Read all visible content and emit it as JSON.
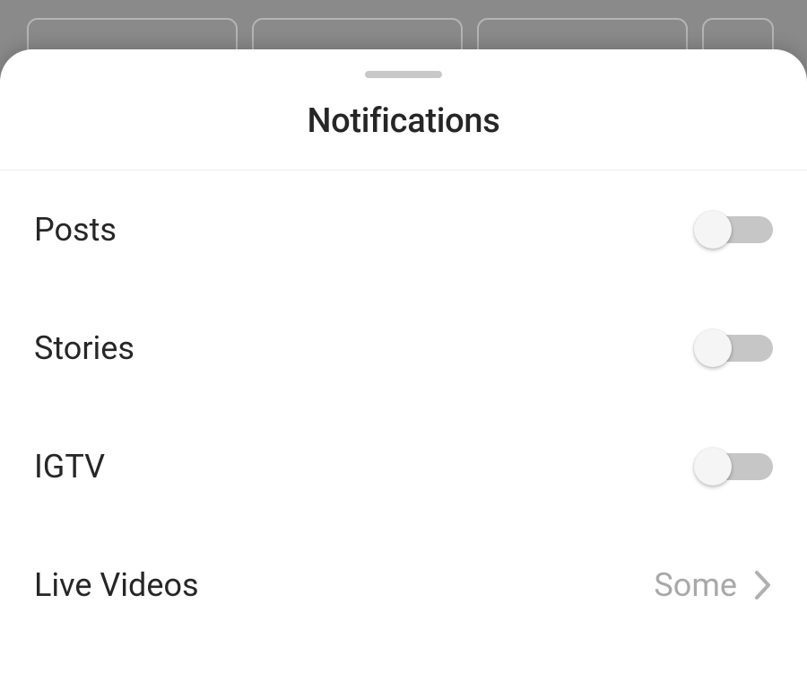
{
  "sheet": {
    "title": "Notifications",
    "rows": {
      "posts": {
        "label": "Posts",
        "state": "off"
      },
      "stories": {
        "label": "Stories",
        "state": "off"
      },
      "igtv": {
        "label": "IGTV",
        "state": "off"
      },
      "live": {
        "label": "Live Videos",
        "value": "Some"
      }
    }
  }
}
